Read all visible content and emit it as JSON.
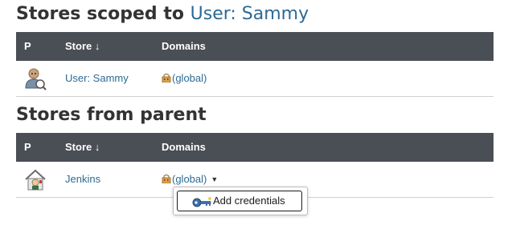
{
  "scoped": {
    "title_prefix": "Stores scoped to",
    "title_link": "User: Sammy",
    "table": {
      "col_p": "P",
      "col_store": "Store ↓",
      "col_domains": "Domains"
    },
    "rows": [
      {
        "store": "User: Sammy",
        "domain": "(global)",
        "icon": "user-avatar-icon"
      }
    ]
  },
  "parent": {
    "title": "Stores from parent",
    "table": {
      "col_p": "P",
      "col_store": "Store ↓",
      "col_domains": "Domains"
    },
    "rows": [
      {
        "store": "Jenkins",
        "domain": "(global)",
        "icon": "jenkins-house-icon"
      }
    ]
  },
  "dropdown": {
    "items": [
      {
        "label": "Add credentials",
        "icon": "key-icon"
      }
    ]
  },
  "colors": {
    "link": "#2d6a94",
    "header_bg": "#4a4e55",
    "header_text": "#ffffff",
    "text": "#333333"
  }
}
